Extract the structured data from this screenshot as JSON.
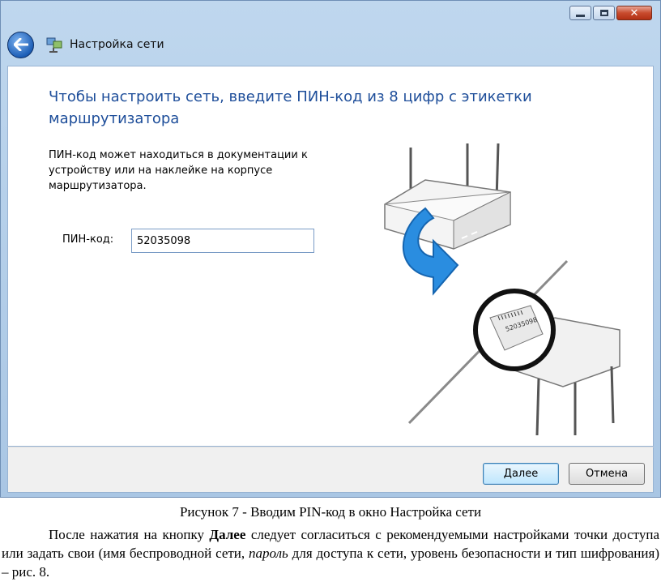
{
  "window": {
    "title": "Настройка сети",
    "caption_buttons": [
      "minimize-icon",
      "maximize-icon",
      "close-icon"
    ]
  },
  "content": {
    "heading": "Чтобы настроить сеть, введите ПИН-код из 8 цифр с этикетки маршрутизатора",
    "description": "ПИН-код может находиться в документации к устройству или на наклейке на корпусе маршрутизатора.",
    "pin_label": "ПИН-код:",
    "pin_value": "52035098",
    "sticker_code": "52035098"
  },
  "footer": {
    "next_label": "Далее",
    "cancel_label": "Отмена"
  },
  "document": {
    "caption": "Рисунок 7 - Вводим PIN-код в окно Настройка сети",
    "para_part1": "После нажатия на кнопку ",
    "para_bold": "Далее",
    "para_part2": " следует согласиться с рекомендуемыми настройками точки доступа или задать свои (имя беспроводной сети, ",
    "para_italic": "пароль",
    "para_part3": " для доступа к сети, уровень безопасности и тип шифрования) – рис. 8."
  },
  "colors": {
    "heading": "#1e4e9a",
    "frame": "#bfd7ee",
    "arrow": "#2a8de0"
  }
}
